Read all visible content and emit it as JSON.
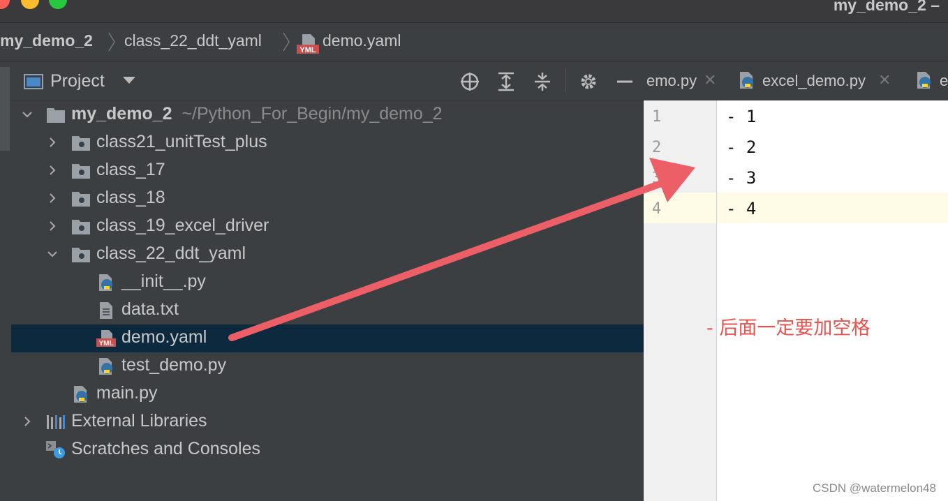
{
  "window": {
    "title": "my_demo_2 –"
  },
  "breadcrumb": [
    "my_demo_2",
    "class_22_ddt_yaml",
    "demo.yaml"
  ],
  "breadcrumb_badge": "YML",
  "project_panel": {
    "title": "Project"
  },
  "tree": [
    {
      "label": "my_demo_2",
      "path": "~/Python_For_Begin/my_demo_2",
      "icon": "folder-icon",
      "expanded": true
    },
    {
      "label": "class21_unitTest_plus",
      "icon": "package-folder-icon",
      "expanded": false
    },
    {
      "label": "class_17",
      "icon": "package-folder-icon",
      "expanded": false
    },
    {
      "label": "class_18",
      "icon": "package-folder-icon",
      "expanded": false
    },
    {
      "label": "class_19_excel_driver",
      "icon": "package-folder-icon",
      "expanded": false
    },
    {
      "label": "class_22_ddt_yaml",
      "icon": "package-folder-icon",
      "expanded": true
    },
    {
      "label": "__init__.py",
      "icon": "python-file-icon"
    },
    {
      "label": "data.txt",
      "icon": "text-file-icon"
    },
    {
      "label": "demo.yaml",
      "icon": "yaml-file-icon",
      "selected": true
    },
    {
      "label": "test_demo.py",
      "icon": "python-file-icon"
    },
    {
      "label": "main.py",
      "icon": "python-file-icon"
    },
    {
      "label": "External Libraries",
      "icon": "libraries-icon",
      "expanded": false
    },
    {
      "label": "Scratches and Consoles",
      "icon": "scratches-icon"
    }
  ],
  "tabs": [
    {
      "label": "emo.py"
    },
    {
      "label": "excel_demo.py"
    },
    {
      "label": "e"
    }
  ],
  "editor": {
    "lines": [
      "- 1",
      "- 2",
      "- 3",
      "- 4"
    ],
    "line_numbers": [
      "1",
      "2",
      "3",
      "4"
    ],
    "current_line": 4
  },
  "annotation": "- 后面一定要加空格",
  "watermark": "CSDN @watermelon48",
  "colors": {
    "annotation": "#e8534f",
    "selection": "#0d293e",
    "arrow": "#ec5f66"
  }
}
